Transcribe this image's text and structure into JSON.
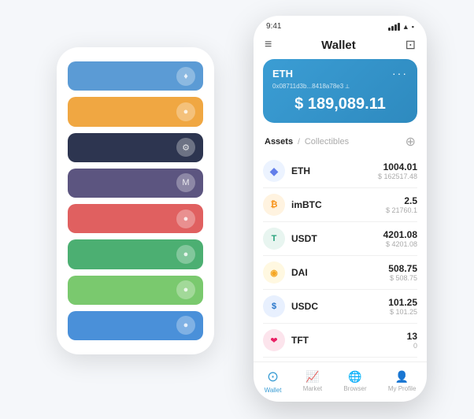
{
  "background_phone": {
    "cards": [
      {
        "color_class": "card-blue",
        "icon": "♦"
      },
      {
        "color_class": "card-orange",
        "icon": "●"
      },
      {
        "color_class": "card-dark",
        "icon": "⚙"
      },
      {
        "color_class": "card-purple",
        "icon": "M"
      },
      {
        "color_class": "card-red",
        "icon": "●"
      },
      {
        "color_class": "card-green",
        "icon": "●"
      },
      {
        "color_class": "card-lightgreen",
        "icon": "●"
      },
      {
        "color_class": "card-blue2",
        "icon": "●"
      }
    ]
  },
  "status_bar": {
    "time": "9:41",
    "wifi": "▲",
    "battery": "█"
  },
  "header": {
    "menu_icon": "≡",
    "title": "Wallet",
    "scan_icon": "⊡"
  },
  "eth_card": {
    "title": "ETH",
    "dots": "···",
    "address": "0x08711d3b...8418a78e3 ⟂",
    "balance": "$ 189,089.11"
  },
  "assets_section": {
    "tab_active": "Assets",
    "separator": "/",
    "tab_inactive": "Collectibles",
    "add_icon": "⊕"
  },
  "assets": [
    {
      "icon": "◆",
      "icon_class": "icon-eth",
      "name": "ETH",
      "amount": "1004.01",
      "value": "$ 162517.48"
    },
    {
      "icon": "₿",
      "icon_class": "icon-imbtc",
      "name": "imBTC",
      "amount": "2.5",
      "value": "$ 21760.1"
    },
    {
      "icon": "T",
      "icon_class": "icon-usdt",
      "name": "USDT",
      "amount": "4201.08",
      "value": "$ 4201.08"
    },
    {
      "icon": "◉",
      "icon_class": "icon-dai",
      "name": "DAI",
      "amount": "508.75",
      "value": "$ 508.75"
    },
    {
      "icon": "$",
      "icon_class": "icon-usdc",
      "name": "USDC",
      "amount": "101.25",
      "value": "$ 101.25"
    },
    {
      "icon": "❤",
      "icon_class": "icon-tft",
      "name": "TFT",
      "amount": "13",
      "value": "0"
    }
  ],
  "nav": [
    {
      "icon": "⊙",
      "label": "Wallet",
      "active": true
    },
    {
      "icon": "📊",
      "label": "Market",
      "active": false
    },
    {
      "icon": "🌐",
      "label": "Browser",
      "active": false
    },
    {
      "icon": "👤",
      "label": "My Profile",
      "active": false
    }
  ]
}
